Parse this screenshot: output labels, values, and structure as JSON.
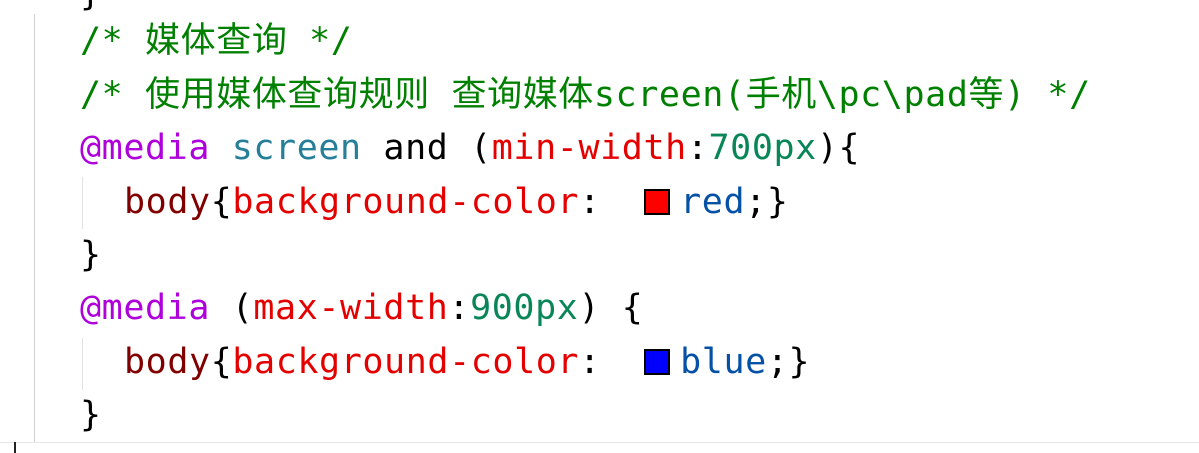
{
  "editor": {
    "previous_line_fragment": "}",
    "lines": {
      "l1": {
        "comment": "/* 媒体查询 */"
      },
      "l2": {
        "comment": "/* 使用媒体查询规则 查询媒体screen(手机\\pc\\pad等) */"
      },
      "l3": {
        "at_rule": "@media",
        "media_type": "screen",
        "keyword": "and",
        "paren_open": "(",
        "feature": "min-width",
        "colon": ":",
        "value": "700px",
        "paren_close": ")",
        "brace_open": "{"
      },
      "l4": {
        "selector": "body",
        "brace_open": "{",
        "property": "background-color",
        "colon": ":",
        "value": "red",
        "semicolon": ";",
        "brace_close": "}",
        "swatch_color": "#ff0000"
      },
      "l5": {
        "brace_close": "}"
      },
      "l6": {
        "at_rule": "@media",
        "paren_open": "(",
        "feature": "max-width",
        "colon": ":",
        "value": "900px",
        "paren_close": ")",
        "brace_open": "{"
      },
      "l7": {
        "selector": "body",
        "brace_open": "{",
        "property": "background-color",
        "colon": ":",
        "value": "blue",
        "semicolon": ";",
        "brace_close": "}",
        "swatch_color": "#0000ff"
      },
      "l8": {
        "brace_close": "}"
      }
    },
    "syntax_colors": {
      "comment": "#008000",
      "at_rule": "#af00db",
      "media_type": "#267f99",
      "property": "#e50000",
      "number": "#098658",
      "selector": "#800000",
      "value": "#0451a5"
    }
  }
}
